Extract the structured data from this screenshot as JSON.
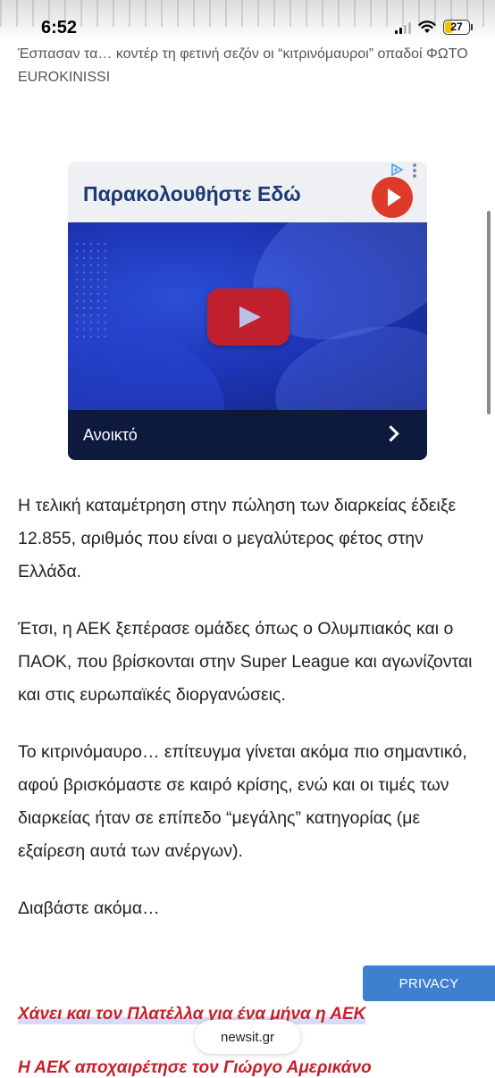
{
  "status_bar": {
    "time": "6:52",
    "battery_level": "27"
  },
  "caption": "Έσπασαν τα… κοντέρ τη φετινή σεζόν οι “κιτρινόμαυροι” οπαδοί ΦΩΤΟ EUROKINISSI",
  "ad": {
    "title": "Παρακολουθήστε Εδώ",
    "footer_label": "Ανοικτό",
    "colors": {
      "header_bg": "#eef0f4",
      "title": "#1b3a72",
      "play": "#dd3a2a",
      "footer_bg": "#0d1a3d"
    },
    "icons": [
      "play-icon",
      "ad-choices-icon",
      "kebab-menu-icon",
      "video-play-icon",
      "chevron-right-icon"
    ]
  },
  "article": {
    "paragraphs": [
      "Η τελική καταμέτρηση στην πώληση των διαρκείας έδειξε 12.855, αριθμός που είναι ο μεγαλύτερος φέτος στην Ελλάδα.",
      "Έτσι, η ΑΕΚ ξεπέρασε ομάδες όπως ο Ολυμπιακός και ο ΠΑΟΚ, που βρίσκονται στην Super League και αγωνίζονται και στις ευρωπαϊκές διοργανώσεις.",
      "Το κιτρινόμαυρο… επίτευγμα γίνεται ακόμα πιο σημαντικό, αφού βρισκόμαστε σε καιρό κρίσης, ενώ και οι τιμές των διαρκείας ήταν σε επίπεδο “μεγάλης” κατηγορίας (με εξαίρεση αυτά των ανέργων).",
      "Διαβάστε ακόμα…"
    ]
  },
  "related_links": [
    "Χάνει και τον Πλατέλλα για ένα μήνα η ΑΕΚ",
    "Η ΑΕΚ αποχαιρέτησε τον Γιώργο Αμερικάνο"
  ],
  "privacy_button": "PRIVACY",
  "browser": {
    "url": "newsit.gr"
  },
  "colors": {
    "link_red": "#c8202a",
    "privacy_blue": "#3f7fd0"
  }
}
